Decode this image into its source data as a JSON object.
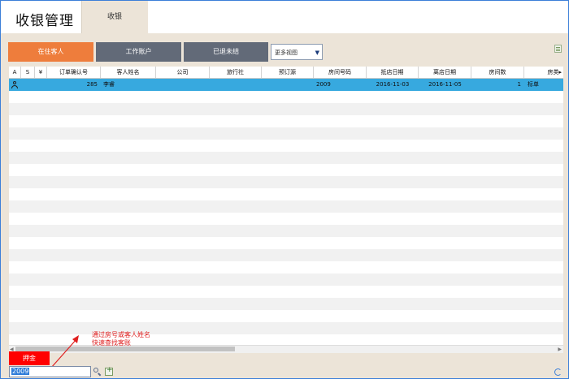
{
  "header": {
    "app_title": "收银管理",
    "tab_label": "收银"
  },
  "toolbar": {
    "in_house_label": "在住客人",
    "work_account_label": "工作账户",
    "checked_out_label": "已退未结",
    "view_select_value": "更多视图"
  },
  "grid": {
    "columns": [
      "A",
      "S",
      "¥",
      "订单确认号",
      "客人姓名",
      "公司",
      "旅行社",
      "预订源",
      "房间号码",
      "抵店日期",
      "离店日期",
      "房间数",
      "房类"
    ],
    "rows": [
      {
        "a": "",
        "s": "",
        "y": "",
        "order_no": "285",
        "guest_name": "李睿",
        "company": "",
        "agency": "",
        "source": "",
        "room_no": "2009",
        "arrive": "2016-11-03",
        "depart": "2016-11-05",
        "rooms": "1",
        "room_type": "标单"
      }
    ]
  },
  "annotation": {
    "line1": "通过房号或客人姓名",
    "line2": "快速查找客账"
  },
  "bottom": {
    "deposit_label": "押金",
    "search_value": "2009"
  },
  "colors": {
    "accent": "#ee7d3c",
    "button_dark": "#626a78",
    "selected_row": "#37a9df",
    "deposit": "#ff0000"
  }
}
